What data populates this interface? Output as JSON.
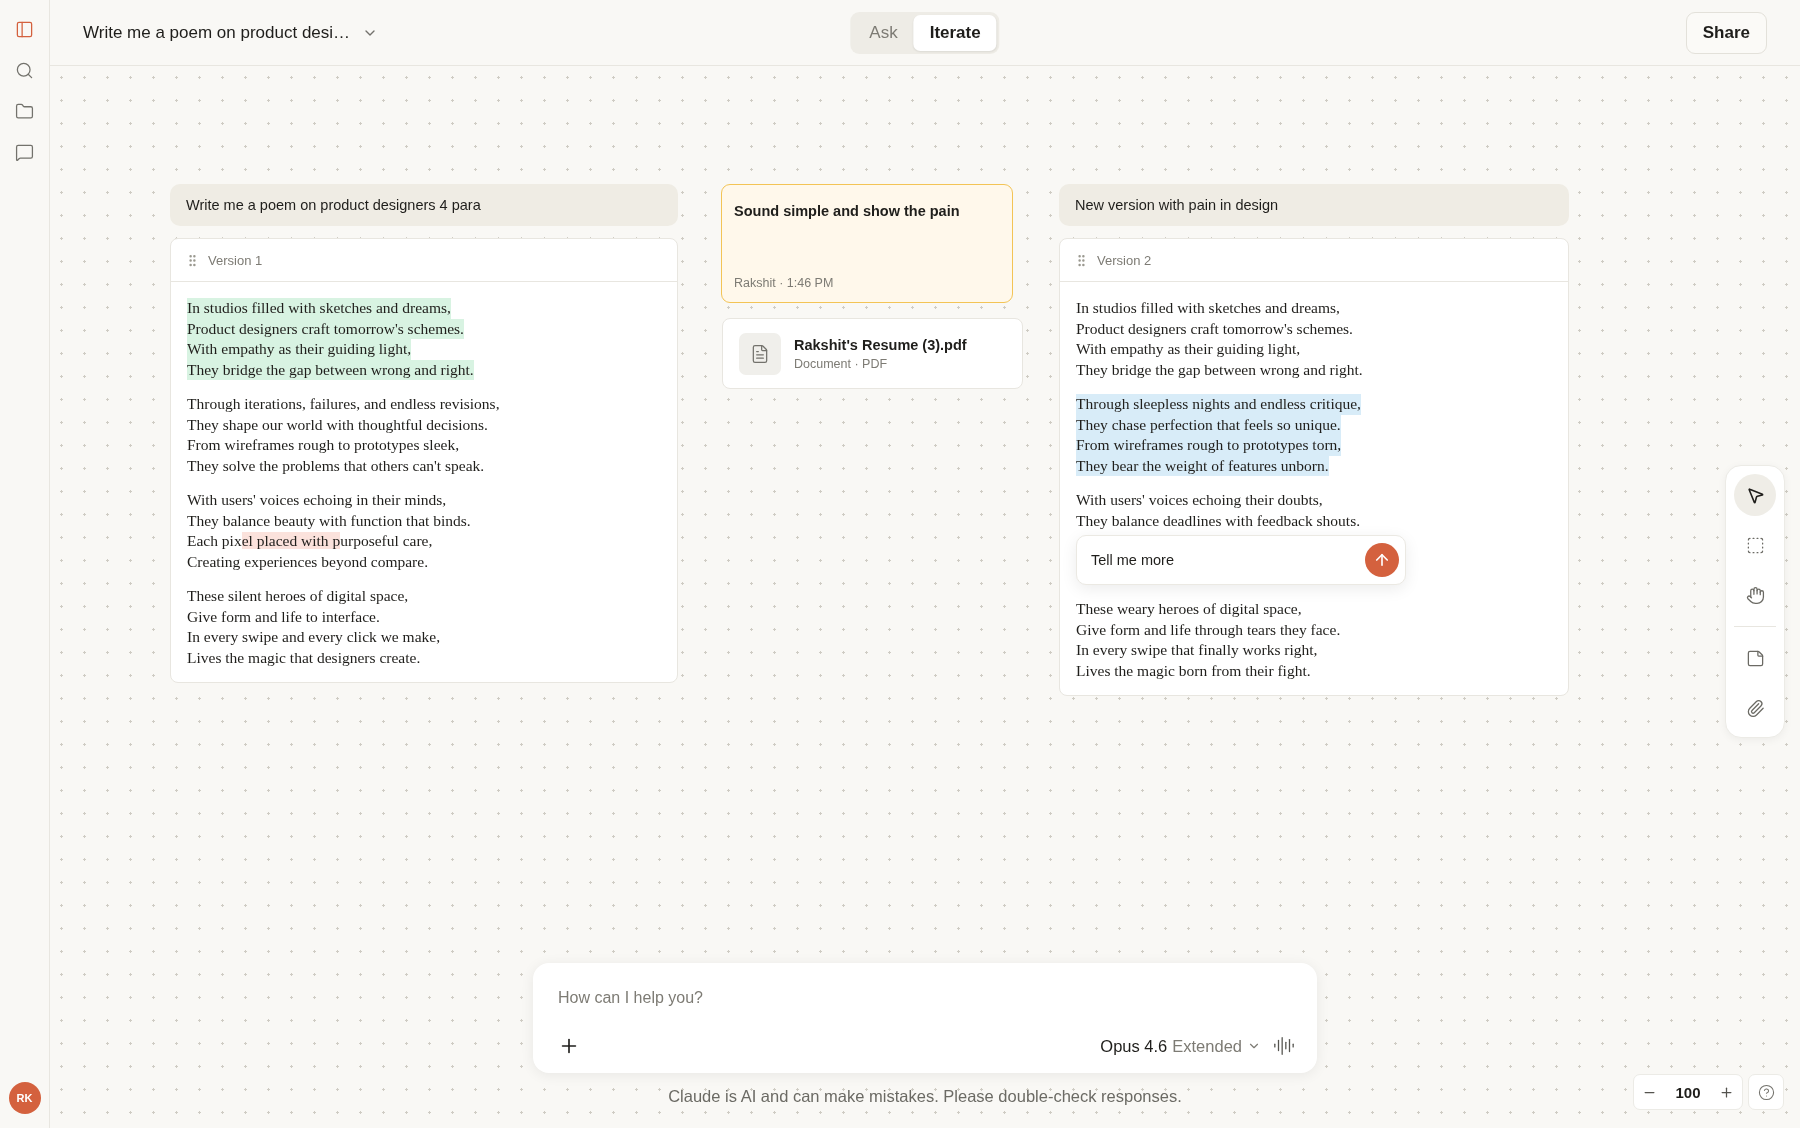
{
  "sidebar": {
    "items": [
      {
        "kind": "panel",
        "selected": true
      },
      {
        "kind": "search",
        "selected": false
      },
      {
        "kind": "folder",
        "selected": false
      },
      {
        "kind": "chats",
        "selected": false
      }
    ],
    "avatar": "RK"
  },
  "header": {
    "title": "Write me a poem on product desi…",
    "tabs": [
      {
        "label": "Ask",
        "selected": false
      },
      {
        "label": "Iterate",
        "selected": true
      }
    ],
    "share": "Share"
  },
  "canvas": {
    "threads": [
      {
        "prompt": "Write me a poem on product designers 4 para",
        "version": "Version 1",
        "stanzas": [
          {
            "color": "#d8f3e2",
            "lines": [
              "In studios filled with sketches and dreams,",
              "Product designers craft tomorrow's schemes.",
              "With empathy as their guiding light,",
              "They bridge the gap between wrong and right."
            ]
          },
          {
            "lines": [
              "Through iterations, failures, and endless revisions,",
              "They shape our world with thoughtful decisions.",
              "From wireframes rough to prototypes sleek,",
              "They solve the problems that others can't speak."
            ]
          },
          {
            "lines": [
              "With users' voices echoing in their minds,",
              "They balance beauty with function that binds.",
              {
                "parts": [
                  {
                    "text": "Each pix"
                  },
                  {
                    "text": "el placed with p",
                    "color": "#fbe2dc"
                  },
                  {
                    "text": "urposeful care,"
                  }
                ]
              },
              "Creating experiences beyond compare."
            ]
          },
          {
            "lines": [
              "These silent heroes of digital space,",
              "Give form and life to interface.",
              "In every swipe and every click we make,",
              "Lives the magic that designers create."
            ]
          }
        ]
      },
      {
        "prompt": "New version with pain in design",
        "version": "Version 2",
        "stanzas": [
          {
            "lines": [
              "In studios filled with sketches and dreams,",
              "Product designers craft tomorrow's schemes.",
              "With empathy as their guiding light,",
              "They bridge the gap between wrong and right."
            ]
          },
          {
            "color": "#d8ecf8",
            "lines": [
              "Through sleepless nights and endless critique,",
              "They chase perfection that feels so unique.",
              "From wireframes rough to prototypes torn,",
              "They bear the weight of features unborn."
            ]
          },
          {
            "lines": [
              "With users' voices echoing their doubts,",
              "They balance deadlines with feedback shouts."
            ],
            "inline_prompt": {
              "value": "Tell me more"
            }
          },
          {
            "lines": [
              "These weary heroes of digital space,",
              "Give form and life through tears they face.",
              "In every swipe that finally works right,",
              "Lives the magic born from their fight."
            ]
          }
        ]
      }
    ],
    "note": {
      "title": "Sound simple and show the pain",
      "meta": "Rakshit · 1:46 PM"
    },
    "attachment": {
      "name": "Rakshit's Resume (3).pdf",
      "meta": "Document · PDF"
    }
  },
  "toolbar": {
    "groups": [
      {
        "tools": [
          {
            "kind": "select",
            "selected": true
          },
          {
            "kind": "marquee",
            "selected": false
          },
          {
            "kind": "hand",
            "selected": false
          }
        ]
      },
      {
        "tools": [
          {
            "kind": "note",
            "selected": false
          },
          {
            "kind": "attach",
            "selected": false
          }
        ]
      }
    ]
  },
  "zoom": {
    "value": "100"
  },
  "composer": {
    "placeholder": "How can I help you?",
    "model": "Opus 4.6",
    "mode": "Extended"
  },
  "disclaimer": "Claude is AI and can make mistakes. Please double-check responses."
}
